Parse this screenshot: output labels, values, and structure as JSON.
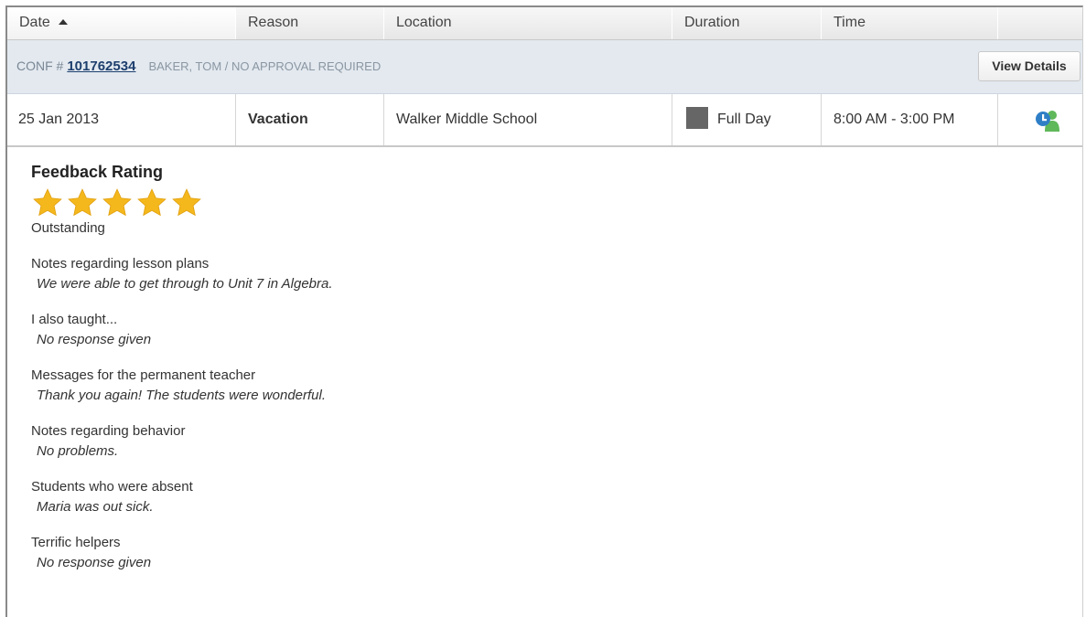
{
  "columns": {
    "date": "Date",
    "reason": "Reason",
    "location": "Location",
    "duration": "Duration",
    "time": "Time"
  },
  "conf": {
    "prefix": "CONF #",
    "number": "101762534",
    "name": "BAKER, TOM / NO APPROVAL REQUIRED",
    "view_details_label": "View Details"
  },
  "row": {
    "date": "25 Jan 2013",
    "reason": "Vacation",
    "location": "Walker Middle School",
    "duration": "Full Day",
    "time": "8:00 AM - 3:00 PM",
    "icon": "user-info-icon"
  },
  "feedback": {
    "title": "Feedback Rating",
    "stars": 5,
    "max_stars": 5,
    "star_color": "#f5b81c",
    "rating_label": "Outstanding",
    "items": [
      {
        "question": "Notes regarding lesson plans",
        "answer": "We were able to get through to Unit 7 in Algebra."
      },
      {
        "question": "I also taught...",
        "answer": "No response given"
      },
      {
        "question": "Messages for the permanent teacher",
        "answer": "Thank you again! The students were wonderful."
      },
      {
        "question": "Notes regarding behavior",
        "answer": "No problems."
      },
      {
        "question": "Students who were absent",
        "answer": "Maria was out sick."
      },
      {
        "question": "Terrific helpers",
        "answer": "No response given"
      }
    ]
  }
}
